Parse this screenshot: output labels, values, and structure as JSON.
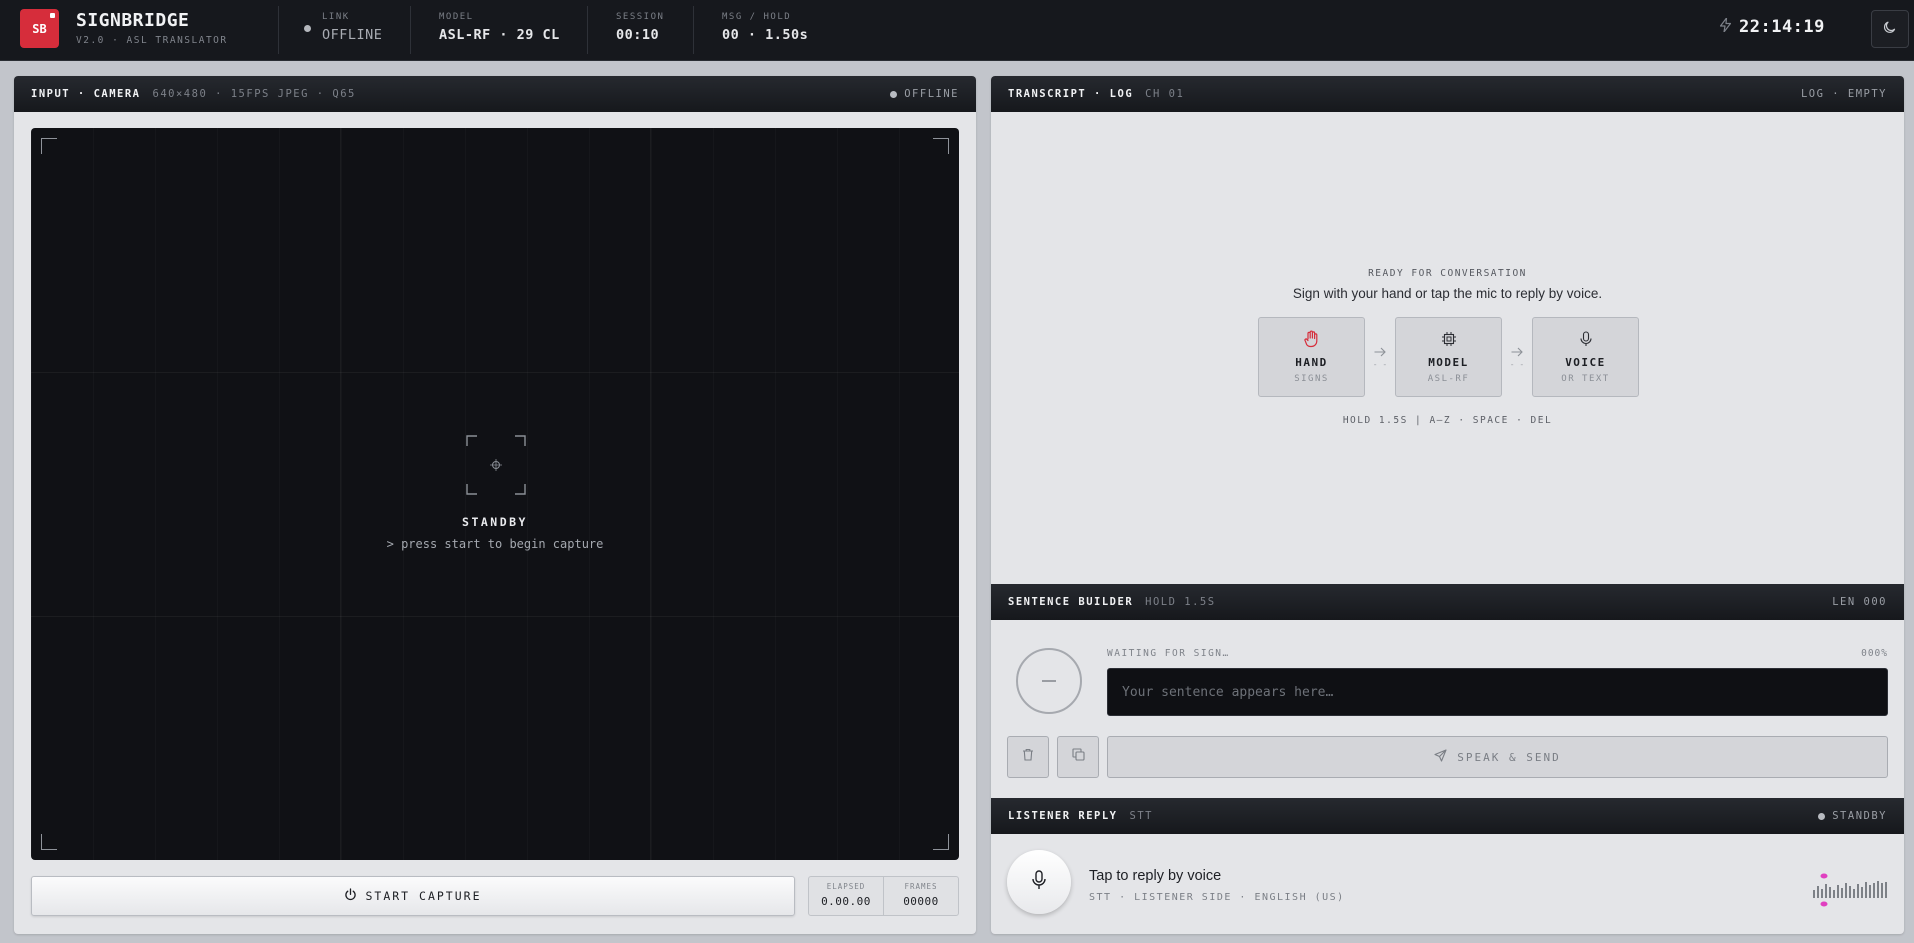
{
  "brand": {
    "logo": "SB",
    "name": "SIGNBRIDGE",
    "version": "V2.0 · ASL TRANSLATOR"
  },
  "status": {
    "link_label": "LINK",
    "link_value": "OFFLINE",
    "model_label": "MODEL",
    "model_value": "ASL-RF · 29 CL",
    "session_label": "SESSION",
    "session_value": "00:10",
    "msg_label": "MSG / HOLD",
    "msg_value": "00 · 1.50s"
  },
  "clock": {
    "icon": "bolt-icon",
    "time": "22:14:19"
  },
  "theme": {
    "icon": "moon-icon"
  },
  "input_panel": {
    "title": "INPUT · CAMERA",
    "spec": "640×480 · 15FPS  JPEG · Q65",
    "status": "OFFLINE",
    "standby": "STANDBY",
    "standby_hint": "> press start to begin capture",
    "start_button": "START CAPTURE",
    "elapsed_label": "ELAPSED",
    "elapsed_value": "0.00.00",
    "frames_label": "FRAMES",
    "frames_value": "00000"
  },
  "transcript_panel": {
    "title": "TRANSCRIPT · LOG",
    "channel": "CH 01",
    "status": "LOG · EMPTY",
    "ready_title": "READY FOR CONVERSATION",
    "ready_text": "Sign with your hand or tap the mic to reply by voice.",
    "steps": [
      {
        "name": "HAND",
        "sub": "SIGNS",
        "icon": "hand-icon"
      },
      {
        "name": "MODEL",
        "sub": "ASL-RF",
        "icon": "chip-icon"
      },
      {
        "name": "VOICE",
        "sub": "OR TEXT",
        "icon": "mic-icon"
      }
    ],
    "arrow_caption": "- -",
    "hint": "HOLD 1.5S | A–Z · SPACE · DEL"
  },
  "sentence_builder": {
    "title": "SENTENCE BUILDER",
    "hold": "HOLD 1.5S",
    "length": "LEN 000",
    "waiting": "WAITING FOR SIGN…",
    "progress": "000%",
    "placeholder": "Your sentence appears here…",
    "speak_button": "SPEAK & SEND"
  },
  "listener": {
    "title": "LISTENER REPLY",
    "mode": "STT",
    "status": "STANDBY",
    "reply_title": "Tap to reply by voice",
    "reply_sub": "STT · LISTENER SIDE · ENGLISH (US)"
  },
  "colors": {
    "accent": "#d62d3b",
    "meter": "#e040c0",
    "dark": "#101115"
  }
}
